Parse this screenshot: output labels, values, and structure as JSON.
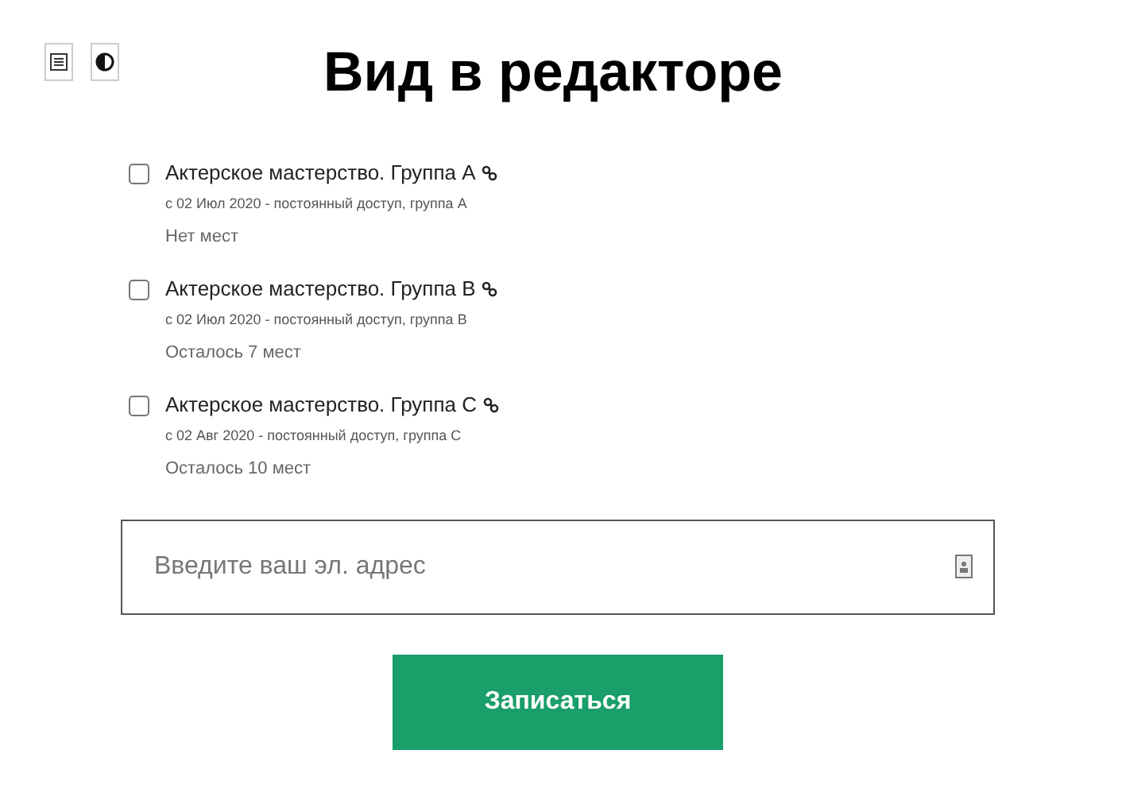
{
  "title": "Вид в редакторе",
  "groups": [
    {
      "name": "Актерское мастерство. Группа A",
      "details": "с 02 Июл 2020 - постоянный доступ, группа A",
      "availability": "Нет мест",
      "checked": false
    },
    {
      "name": "Актерское мастерство. Группа B",
      "details": "с 02 Июл 2020 - постоянный доступ, группа B",
      "availability": "Осталось 7 мест",
      "checked": false
    },
    {
      "name": "Актерское мастерство. Группа C",
      "details": "с 02 Авг 2020 - постоянный доступ, группа C",
      "availability": "Осталось 10 мест",
      "checked": false
    }
  ],
  "email": {
    "placeholder": "Введите ваш эл. адрес"
  },
  "submit": "Записаться"
}
